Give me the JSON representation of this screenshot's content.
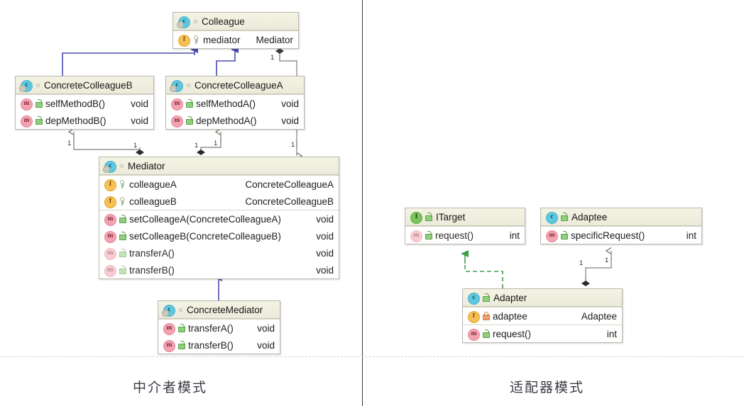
{
  "page": {
    "caption_left": "中介者模式",
    "caption_right": "适配器模式"
  },
  "colors": {
    "class_icon": "#5fc8e0",
    "interface_icon": "#7bc45c",
    "field_icon": "#f6c054",
    "method_icon": "#f3a2b0",
    "header_fill": "#f1efdf",
    "box_border": "#b9b9ae",
    "inheritance_edge": "#4a4ab0",
    "association_edge": "#7d7d75",
    "realization_edge": "#3f9e4d",
    "divider": "#3a3a3a"
  },
  "mediator_diagram": {
    "classes": {
      "colleague": {
        "name": "Colleague",
        "stereotype_icon": "class-icon",
        "abstract": true,
        "members": [
          {
            "icon": "field-icon",
            "visibility": "protected",
            "name": "mediator",
            "type": "Mediator",
            "dim": false
          }
        ]
      },
      "concrete_colleague_b": {
        "name": "ConcreteColleagueB",
        "stereotype_icon": "class-icon",
        "abstract": true,
        "members": [
          {
            "icon": "method-icon",
            "visibility": "public",
            "name": "selfMethodB()",
            "type": "void",
            "dim": false
          },
          {
            "icon": "method-icon",
            "visibility": "public",
            "name": "depMethodB()",
            "type": "void",
            "dim": false
          }
        ]
      },
      "concrete_colleague_a": {
        "name": "ConcreteColleagueA",
        "stereotype_icon": "class-icon",
        "abstract": true,
        "members": [
          {
            "icon": "method-icon",
            "visibility": "public",
            "name": "selfMethodA()",
            "type": "void",
            "dim": false
          },
          {
            "icon": "method-icon",
            "visibility": "public",
            "name": "depMethodA()",
            "type": "void",
            "dim": false
          }
        ]
      },
      "mediator": {
        "name": "Mediator",
        "stereotype_icon": "class-icon",
        "abstract": true,
        "fields": [
          {
            "icon": "field-icon",
            "visibility": "protected",
            "name": "colleagueA",
            "type": "ConcreteColleagueA",
            "dim": false
          },
          {
            "icon": "field-icon",
            "visibility": "protected",
            "name": "colleagueB",
            "type": "ConcreteColleagueB",
            "dim": false
          }
        ],
        "methods": [
          {
            "icon": "method-icon",
            "visibility": "public",
            "name": "setColleageA(ConcreteColleagueA)",
            "type": "void",
            "dim": false
          },
          {
            "icon": "method-icon",
            "visibility": "public",
            "name": "setColleageB(ConcreteColleagueB)",
            "type": "void",
            "dim": false
          },
          {
            "icon": "method-icon",
            "visibility": "public",
            "name": "transferA()",
            "type": "void",
            "dim": true
          },
          {
            "icon": "method-icon",
            "visibility": "public",
            "name": "transferB()",
            "type": "void",
            "dim": true
          }
        ]
      },
      "concrete_mediator": {
        "name": "ConcreteMediator",
        "stereotype_icon": "class-icon",
        "abstract": true,
        "members": [
          {
            "icon": "method-icon",
            "visibility": "public",
            "name": "transferA()",
            "type": "void",
            "dim": false
          },
          {
            "icon": "method-icon",
            "visibility": "public",
            "name": "transferB()",
            "type": "void",
            "dim": false
          }
        ]
      }
    },
    "edge_labels": {
      "colleague_to_mediator": "1",
      "mediator_to_colleague_b_src": "1",
      "mediator_to_colleague_b_dst": "1",
      "mediator_to_colleague_a_src": "1",
      "mediator_to_colleague_a_dst": "1",
      "mediator_down_a": "1",
      "mediator_down_b": "1"
    }
  },
  "adapter_diagram": {
    "classes": {
      "itarget": {
        "name": "ITarget",
        "stereotype_icon": "interface-icon",
        "abstract": false,
        "members": [
          {
            "icon": "method-icon",
            "visibility": "public",
            "name": "request()",
            "type": "int",
            "dim": true
          }
        ]
      },
      "adaptee": {
        "name": "Adaptee",
        "stereotype_icon": "class-icon",
        "abstract": false,
        "members": [
          {
            "icon": "method-icon",
            "visibility": "public",
            "name": "specificRequest()",
            "type": "int",
            "dim": false
          }
        ]
      },
      "adapter": {
        "name": "Adapter",
        "stereotype_icon": "class-icon",
        "abstract": false,
        "fields": [
          {
            "icon": "field-icon",
            "visibility": "private",
            "name": "adaptee",
            "type": "Adaptee",
            "dim": false
          }
        ],
        "methods": [
          {
            "icon": "method-icon",
            "visibility": "public",
            "name": "request()",
            "type": "int",
            "dim": false
          }
        ]
      }
    },
    "edge_labels": {
      "adapter_to_adaptee_src": "1",
      "adapter_to_adaptee_dst": "1"
    }
  }
}
